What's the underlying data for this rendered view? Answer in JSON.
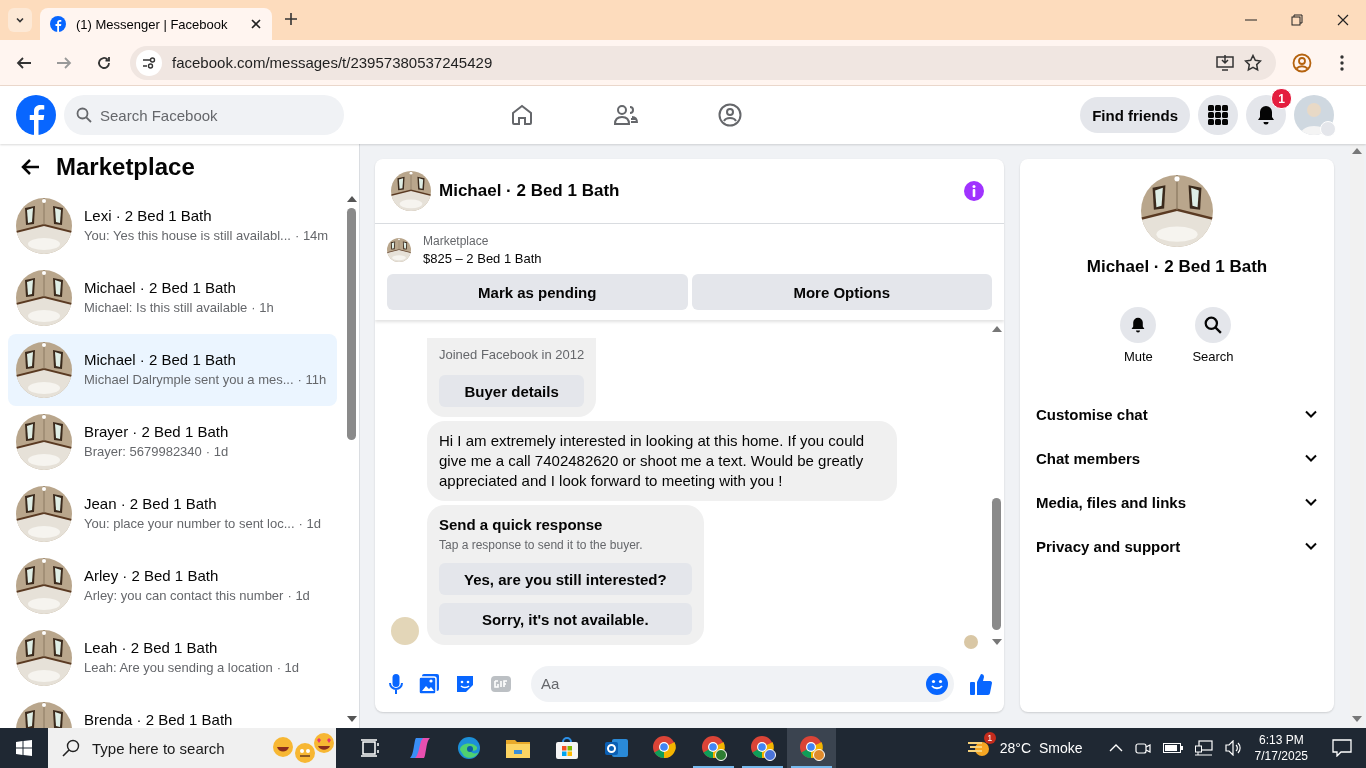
{
  "browser": {
    "tab_title": "(1) Messenger | Facebook",
    "url": "facebook.com/messages/t/23957380537245429"
  },
  "header": {
    "search_placeholder": "Search Facebook",
    "find_friends": "Find friends",
    "notification_count": "1"
  },
  "sidebar": {
    "title": "Marketplace",
    "conversations": [
      {
        "name": "Lexi · 2 Bed 1 Bath",
        "preview": "You: Yes this house is still availabl...",
        "time": "· 14m",
        "selected": false
      },
      {
        "name": "Michael · 2 Bed 1 Bath",
        "preview": "Michael: Is this still available",
        "time": "· 1h",
        "selected": false
      },
      {
        "name": "Michael · 2 Bed 1 Bath",
        "preview": "Michael Dalrymple sent you a mes...",
        "time": "· 11h",
        "selected": true
      },
      {
        "name": "Brayer · 2 Bed 1 Bath",
        "preview": "Brayer: 5679982340",
        "time": "· 1d",
        "selected": false
      },
      {
        "name": "Jean · 2 Bed 1 Bath",
        "preview": "You: place your number to sent loc...",
        "time": "· 1d",
        "selected": false
      },
      {
        "name": "Arley · 2 Bed 1 Bath",
        "preview": "Arley: you can contact this number",
        "time": "· 1d",
        "selected": false
      },
      {
        "name": "Leah · 2 Bed 1 Bath",
        "preview": "Leah: Are you sending a location",
        "time": "· 1d",
        "selected": false
      },
      {
        "name": "Brenda · 2 Bed 1 Bath",
        "selected": false
      }
    ]
  },
  "chat": {
    "title": "Michael · 2 Bed 1 Bath",
    "listing": {
      "label": "Marketplace",
      "detail": "$825 – 2 Bed 1 Bath"
    },
    "actions": [
      "Mark as pending",
      "More Options"
    ],
    "buyer_card": {
      "joined": "Joined Facebook in 2012",
      "button": "Buyer details"
    },
    "message": "Hi I am extremely interested in looking at this home. If you could give me a call 7402482620 or shoot me a text. Would be greatly appreciated and I look forward to meeting with you !",
    "quick_response": {
      "title": "Send a quick response",
      "hint": "Tap a response to send it to the buyer.",
      "options": [
        "Yes, are you still interested?",
        "Sorry, it's not available."
      ]
    },
    "composer_placeholder": "Aa"
  },
  "details": {
    "name": "Michael · 2 Bed 1 Bath",
    "actions": [
      "Mute",
      "Search"
    ],
    "sections": [
      "Customise chat",
      "Chat members",
      "Media, files and links",
      "Privacy and support"
    ]
  },
  "taskbar": {
    "search_placeholder": "Type here to search",
    "weather_badge": "1",
    "temperature": "28°C",
    "weather": "Smoke",
    "time": "6:13 PM",
    "date": "7/17/2025"
  }
}
